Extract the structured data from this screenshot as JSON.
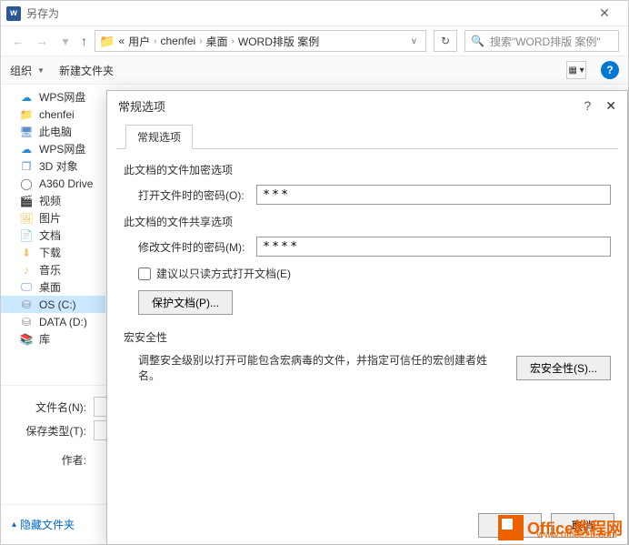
{
  "titlebar": {
    "title": "另存为"
  },
  "nav": {
    "crumb0": "«",
    "crumb1": "用户",
    "crumb2": "chenfei",
    "crumb3": "桌面",
    "crumb4": "WORD排版 案例",
    "search_icon": "⌕",
    "search_placeholder": "搜索\"WORD排版 案例\""
  },
  "toolbar": {
    "organize": "组织",
    "newfolder": "新建文件夹"
  },
  "sidebar": {
    "items": [
      {
        "label": "WPS网盘"
      },
      {
        "label": "chenfei"
      },
      {
        "label": "此电脑"
      },
      {
        "label": "WPS网盘"
      },
      {
        "label": "3D 对象"
      },
      {
        "label": "A360 Drive"
      },
      {
        "label": "视频"
      },
      {
        "label": "图片"
      },
      {
        "label": "文档"
      },
      {
        "label": "下载"
      },
      {
        "label": "音乐"
      },
      {
        "label": "桌面"
      },
      {
        "label": "OS (C:)"
      },
      {
        "label": "DATA (D:)"
      },
      {
        "label": "库"
      }
    ]
  },
  "bottom": {
    "filename_label": "文件名(N):",
    "filetype_label": "保存类型(T):",
    "author_label": "作者:"
  },
  "footer": {
    "hide_folders": "隐藏文件夹"
  },
  "dialog": {
    "title": "常规选项",
    "tab": "常规选项",
    "section_encrypt": "此文档的文件加密选项",
    "open_pw_label": "打开文件时的密码(O):",
    "open_pw_value": "***",
    "section_share": "此文档的文件共享选项",
    "modify_pw_label": "修改文件时的密码(M):",
    "modify_pw_value": "****",
    "readonly_label": "建议以只读方式打开文档(E)",
    "protect_btn": "保护文档(P)...",
    "section_macro": "宏安全性",
    "macro_desc": "调整安全级别以打开可能包含宏病毒的文件，并指定可信任的宏创建者姓名。",
    "macro_btn": "宏安全性(S)...",
    "ok": "确定",
    "cancel": "取消"
  },
  "watermark": {
    "line1": "Office教程网",
    "line2": "www.office26.com"
  }
}
